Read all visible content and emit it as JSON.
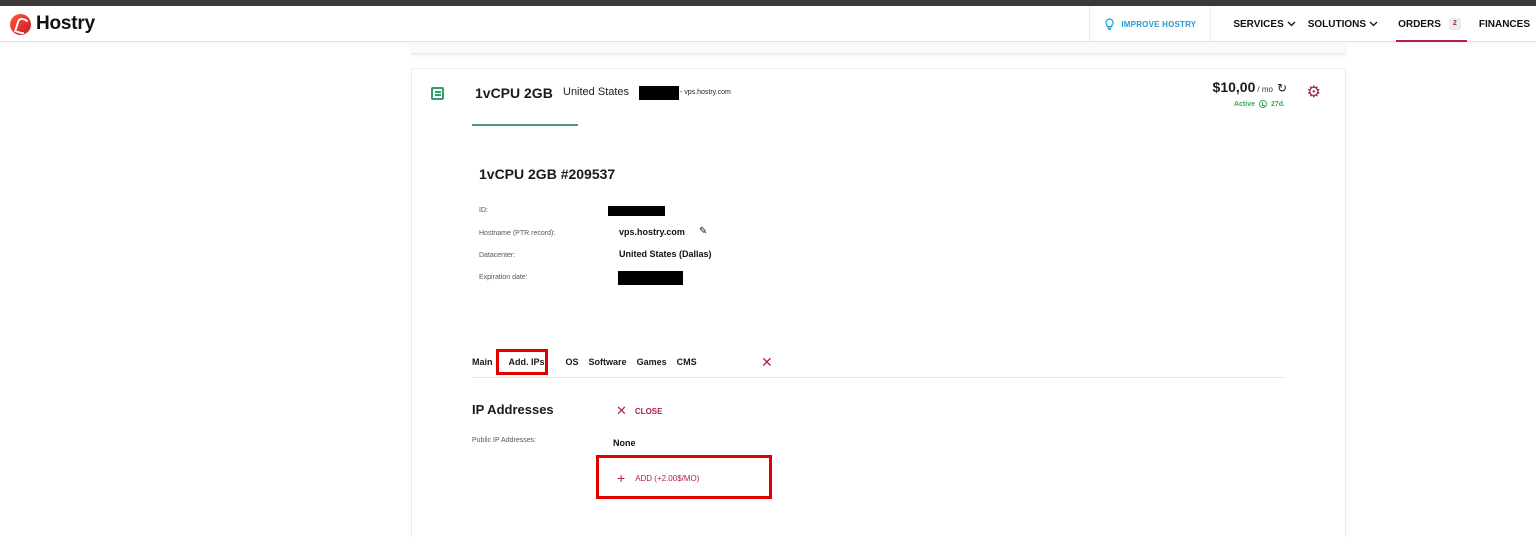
{
  "app": {
    "brand": "Hostry",
    "accent_color": "#b0204a",
    "status_color": "#3aa857"
  },
  "nav": {
    "improve_label": "IMPROVE HOSTRY",
    "items": [
      {
        "label": "SERVICES",
        "has_chevron": true
      },
      {
        "label": "SOLUTIONS",
        "has_chevron": true
      },
      {
        "label": "ORDERS",
        "badge": "2",
        "active": true
      },
      {
        "label": "FINANCES"
      }
    ]
  },
  "service": {
    "plan": "1vCPU 2GB",
    "location": "United States",
    "host_suffix": "- vps.hostry.com",
    "price": "$10,00",
    "period": "/ mo",
    "status": "Active",
    "days_left": "27d."
  },
  "details": {
    "title": "1vCPU 2GB #209537",
    "rows": [
      {
        "label": "ID:",
        "value": "",
        "redacted": true
      },
      {
        "label": "Hostname (PTR record):",
        "value": "vps.hostry.com",
        "editable": true
      },
      {
        "label": "Datacenter:",
        "value": "United States (Dallas)"
      },
      {
        "label": "Expiration date:",
        "value": "",
        "redacted": true
      }
    ]
  },
  "tabs": {
    "items": [
      "Main",
      "Add. IPs",
      "OS",
      "Software",
      "Games",
      "CMS"
    ],
    "active": "Add. IPs"
  },
  "ip_panel": {
    "title": "IP Addresses",
    "close_label": "CLOSE",
    "public_label": "Public IP Addresses:",
    "public_value": "None",
    "add_label": "ADD (+2.00$/MO)"
  }
}
